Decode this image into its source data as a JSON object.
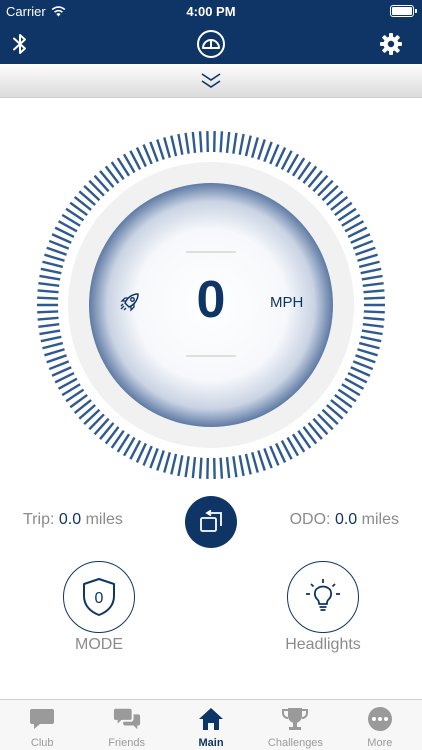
{
  "status_bar": {
    "carrier": "Carrier",
    "time": "4:00 PM"
  },
  "nav": {
    "left_icon": "bluetooth-icon",
    "center_icon": "speedometer-icon",
    "right_icon": "gear-icon"
  },
  "colors": {
    "primary": "#0f3567",
    "muted_text": "#8b8b8b",
    "tab_inactive": "#9a9a9a"
  },
  "speed": {
    "value": "0",
    "unit": "MPH",
    "mode_icon": "rocket-icon"
  },
  "stats": {
    "trip": {
      "label": "Trip:",
      "value": "0.0",
      "unit": "miles"
    },
    "odo": {
      "label": "ODO:",
      "value": "0.0",
      "unit": "miles"
    }
  },
  "controls": {
    "mode": {
      "label": "MODE",
      "badge": "0",
      "icon": "shield-icon"
    },
    "headlights": {
      "label": "Headlights",
      "icon": "lightbulb-icon"
    }
  },
  "tabs": [
    {
      "label": "Club",
      "icon": "chat-bubble-icon",
      "active": false
    },
    {
      "label": "Friends",
      "icon": "chat-bubbles-icon",
      "active": false
    },
    {
      "label": "Main",
      "icon": "home-icon",
      "active": true
    },
    {
      "label": "Challenges",
      "icon": "trophy-icon",
      "active": false
    },
    {
      "label": "More",
      "icon": "more-icon",
      "active": false
    }
  ]
}
